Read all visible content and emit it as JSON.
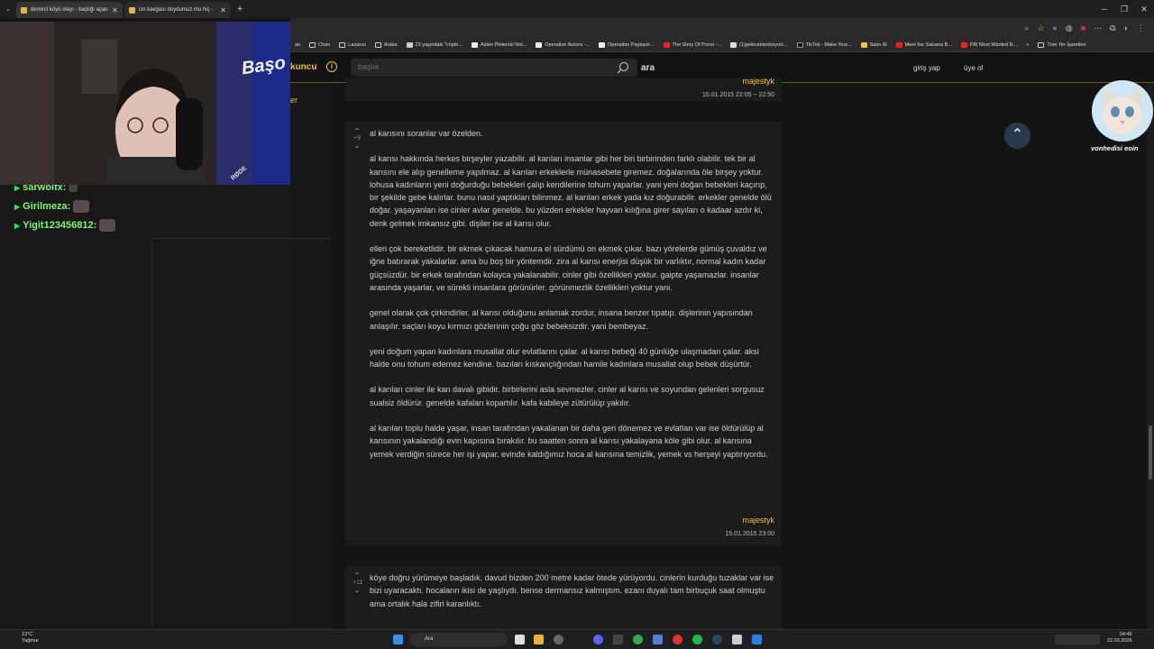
{
  "browser": {
    "tabs": [
      {
        "title": "demirci köyü olayı - başlığı açan"
      },
      {
        "title": "cin kavgası duydumuz mu hiç -"
      }
    ],
    "bookmarks": [
      "an",
      "Chao",
      "Lazarus",
      "Araba",
      "23 yaşındaki \"cripto...",
      "Aiden Pleterski Net...",
      "Operation Aurora -...",
      "Operation Payback...",
      "The Story Of Ponzi -...",
      "(1)gelecektenbeyolc...",
      "TikTok - Make Your...",
      "Satın Al",
      "Meet the Sakawa B...",
      "FBI Most Wanted R...",
      "»",
      "Tüm Yer İşaretleri"
    ]
  },
  "site": {
    "name": "kuncu",
    "search_placeholder": "başlık",
    "search_button": "ara",
    "login": "giriş yap",
    "signup": "üye ol",
    "left_label": "er"
  },
  "stream": {
    "chat": [
      {
        "user": "sarwolfx:"
      },
      {
        "user": "Girilmeza:"
      },
      {
        "user": "Yigit123456812:"
      }
    ],
    "overlay_logo": "Başo",
    "mic_brand": "RØDE",
    "cat_caption": "vonhedisi eoin"
  },
  "entries": [
    {
      "author": "majestyk",
      "date": "15.01.2015 22:05 ~ 22:50"
    },
    {
      "votes": "+9",
      "author": "majestyk",
      "date": "15.01.2015 23:00",
      "paragraphs": [
        "al karısını soranlar var özelden.",
        "al karısı hakkında herkes birşeyler yazabilir. al karıları insanlar gibi her biri birbirinden farklı olabilir. tek bir al karısını ele alıp genelleme yapılmaz. al karıları erkeklerle münasebete giremez. doğalarında öle birşey yoktur. lohusa kadınların yeni doğurduğu bebekleri çalıp kendilerine tohum yaparlar. yani yeni doğan bebekleri kaçırıp, bir şekilde gebe kalırlar. bunu nasıl yaptıkları bilinmez. al karıları erkek yada kız doğurabilir. erkekler genelde ölü doğar. yaşayanları ise cinler avlar genelde. bu yüzden erkekler hayvan kılığına girer sayıları o kadaar azdır ki, denk gelmek imkansız gibi. dişiler ise al karısı olur.",
        "elleri çok bereketlidir. bir ekmek çıkacak hamura el sürdümü on ekmek çıkar. bazı yörelerde gümüş çuvaldız ve iğne batırarak yakalarlar. ama bu boş bir yöntemdir. zira al karısı enerjisi düşük bir varlıktır, normal kadın kadar güçsüzdür. bir erkek tarafından kolayca yakalanabilir. cinler gibi özellikleri yoktur. gaipte yaşamazlar. insanlar arasında yaşarlar, ve sürekli insanlara görünürler. görünmezlik özellikleri yoktur yani.",
        "genel olarak çok çirkindirler. al karısı olduğunu anlamak zordur, insana benzer tıpatıp. dişlerinin yapısından anlaşılır. saçları koyu kırmızı gözlerinin çoğu göz bebeksizdir. yani bembeyaz.",
        "yeni doğum yapan kadınlara musallat olur evlatlarını çalar. al karısı bebeği 40 günlüğe ulaşmadan çalar. aksi halde onu tohum edemez kendine. bazıları kıskançlığından hamile kadınlara musallat olup bebek düşürtür.",
        "al karıları cinler ile kan davalı gibidir. birbirlerini asla sevmezler. cinler al karısı ve soyundan gelenleri sorgusuz sualsiz öldürür. genelde kafaları kopartılır. kafa kabileye zütürülüp yakılır.",
        "al karıları toplu halde yaşar, insan tarafından yakalanan bir daha geri dönemez ve evlatları var ise öldürülüp al karısının yakalandığı evin kapısına bırakılır. bu saatten sonra al karısı yakalayana köle gibi olur. al karısına yemek verdiğin sürece her işi yapar. evinde kaldığımız hoca al karısına temizlik, yemek vs herşeyi yaptırıyordu."
      ]
    },
    {
      "votes": "+11",
      "paragraphs": [
        "köye doğru yürümeye başladık. davud bizden 200 metre kadar ötede yürüyordu. cinlerin kurduğu tuzaklar var ise bizi uyaracaktı. hocaların ikisi de yaşlıydı. bense dermansız kalmıştım. ezanı duyalı tam birbuçuk saat olmuştu ama ortalık hala zifiri karanlıktı."
      ]
    }
  ],
  "taskbar": {
    "temp": "13°C",
    "weather": "Yağmur",
    "search": "Ara",
    "time": "04:46",
    "date": "22.03.2026"
  }
}
